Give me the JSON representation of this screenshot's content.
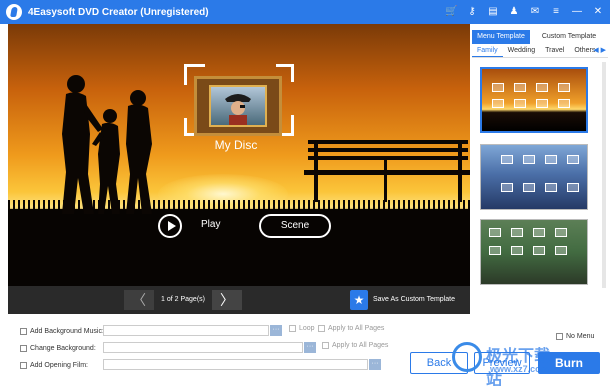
{
  "window": {
    "title": "4Easysoft DVD Creator (Unregistered)",
    "toolbar_icons": [
      "cart-icon",
      "key-icon",
      "file-icon",
      "user-icon",
      "feedback-icon",
      "menu-icon",
      "minimize-icon",
      "close-icon"
    ],
    "toolbar_glyphs": [
      "🛒",
      "⚷",
      "▤",
      "♟",
      "✉",
      "≡",
      "—",
      "✕"
    ],
    "accent_color": "#2b7ae8"
  },
  "preview": {
    "disc_title": "My Disc",
    "play_label": "Play",
    "scene_label": "Scene",
    "page_info": "1 of 2 Page(s)",
    "prev_glyph": "〈",
    "next_glyph": "〉",
    "save_template_label": "Save As Custom Template",
    "save_icon_glyph": "★"
  },
  "sidebar": {
    "tabs": [
      {
        "label": "Menu Template",
        "active": true
      },
      {
        "label": "Custom Template",
        "active": false
      }
    ],
    "categories": [
      {
        "label": "Family",
        "active": true
      },
      {
        "label": "Wedding",
        "active": false
      },
      {
        "label": "Travel",
        "active": false
      },
      {
        "label": "Others",
        "active": false
      }
    ],
    "category_arrows": "◀ ▶",
    "templates": [
      {
        "name": "family-sunset",
        "selected": true
      },
      {
        "name": "family-blue",
        "selected": false
      },
      {
        "name": "family-park",
        "selected": false
      }
    ]
  },
  "options": {
    "add_music_label": "Add Background Music:",
    "loop_label": "Loop",
    "apply_all_label_1": "Apply to All Pages",
    "change_background_label": "Change Background:",
    "apply_all_label_2": "Apply to All Pages",
    "add_opening_label": "Add Opening Film:",
    "browse_glyph": "···",
    "no_menu_label": "No Menu"
  },
  "actions": {
    "back_label": "Back",
    "preview_label": "Preview",
    "burn_label": "Burn"
  },
  "watermark": {
    "text": "极光下载站",
    "url": "www.xz7.com"
  }
}
